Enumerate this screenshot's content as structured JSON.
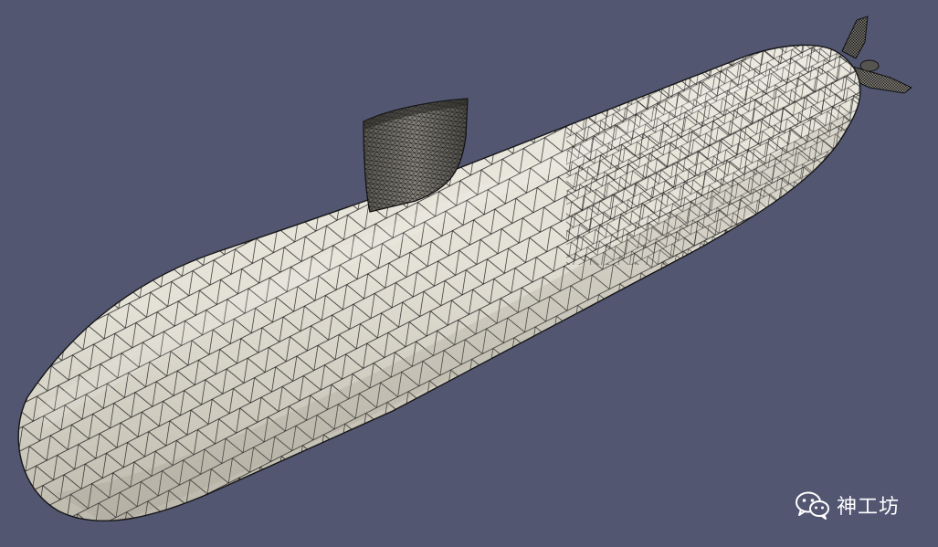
{
  "scene": {
    "subject": "submarine-hull-surface-mesh",
    "background_color": "#525671",
    "surface_color": "#e4e1d6",
    "shadow_color": "#b9b5a8",
    "mesh_line_color": "#1b1b1b"
  },
  "watermark": {
    "icon": "wechat-icon",
    "text": "神工坊"
  }
}
